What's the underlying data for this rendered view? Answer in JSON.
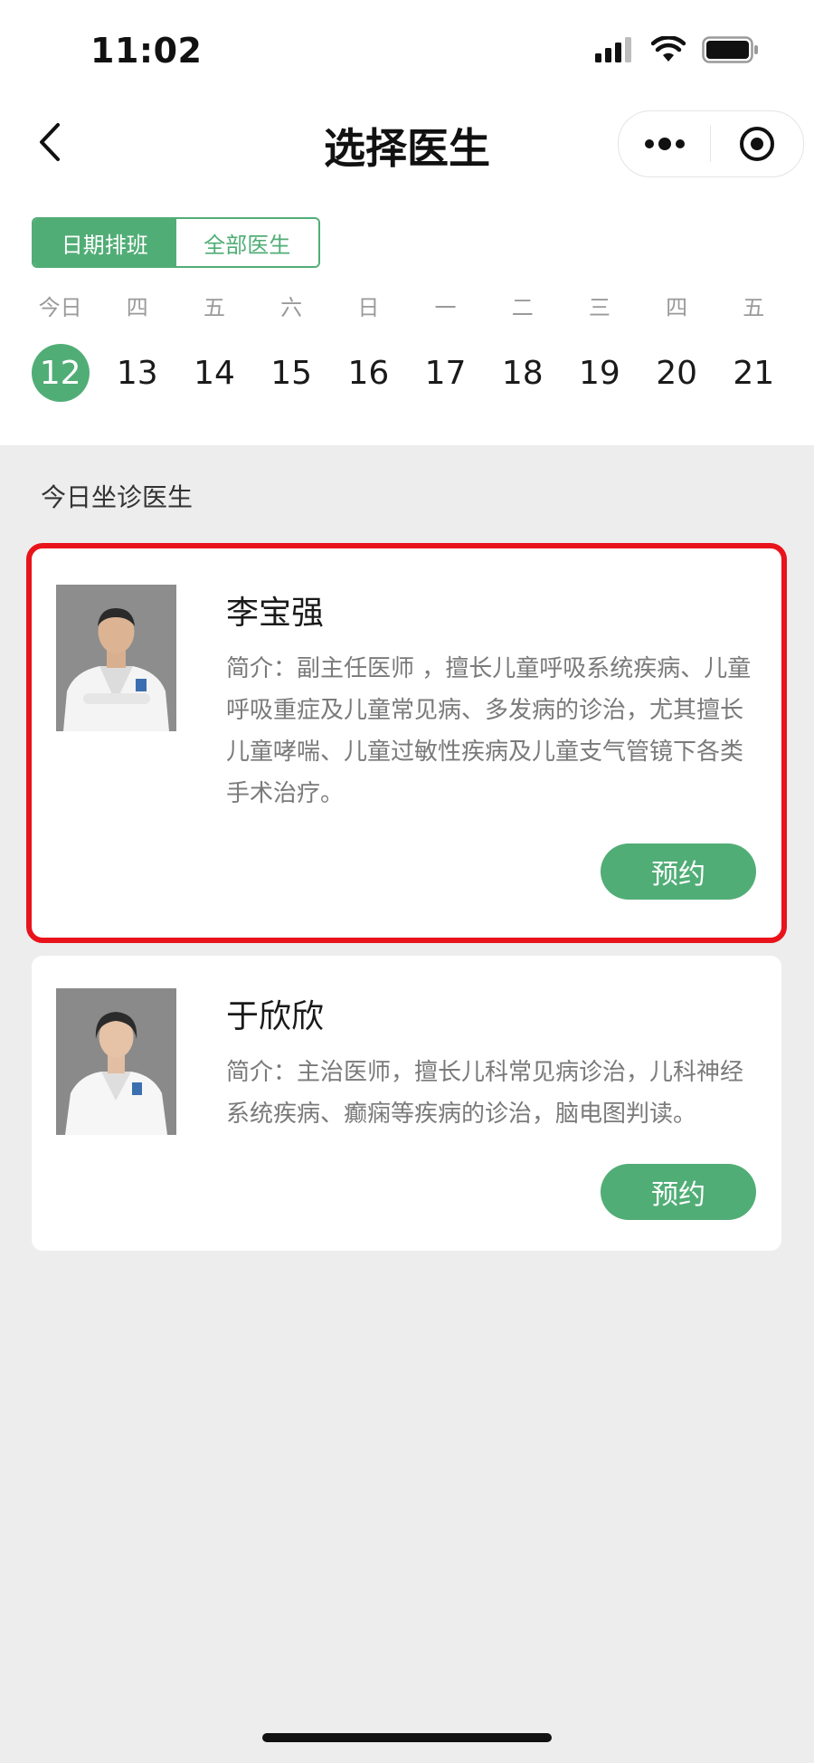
{
  "status_bar": {
    "time": "11:02"
  },
  "nav": {
    "title": "选择医生"
  },
  "tabs": [
    {
      "label": "日期排班",
      "active": true
    },
    {
      "label": "全部医生",
      "active": false
    }
  ],
  "calendar": {
    "weekdays": [
      "今日",
      "四",
      "五",
      "六",
      "日",
      "一",
      "二",
      "三",
      "四",
      "五"
    ],
    "dates": [
      "12",
      "13",
      "14",
      "15",
      "16",
      "17",
      "18",
      "19",
      "20",
      "21"
    ],
    "selected_index": 0
  },
  "section_title": "今日坐诊医生",
  "doctors": [
    {
      "name": "李宝强",
      "intro": "简介：副主任医师 ，擅长儿童呼吸系统疾病、儿童呼吸重症及儿童常见病、多发病的诊治，尤其擅长儿童哮喘、儿童过敏性疾病及儿童支气管镜下各类手术治疗。",
      "book_label": "预约"
    },
    {
      "name": "于欣欣",
      "intro": "简介：主治医师，擅长儿科常见病诊治，儿科神经系统疾病、癫痫等疾病的诊治，脑电图判读。",
      "book_label": "预约"
    }
  ],
  "colors": {
    "accent": "#51ad76",
    "highlight": "#e8131b",
    "background": "#ededed"
  }
}
